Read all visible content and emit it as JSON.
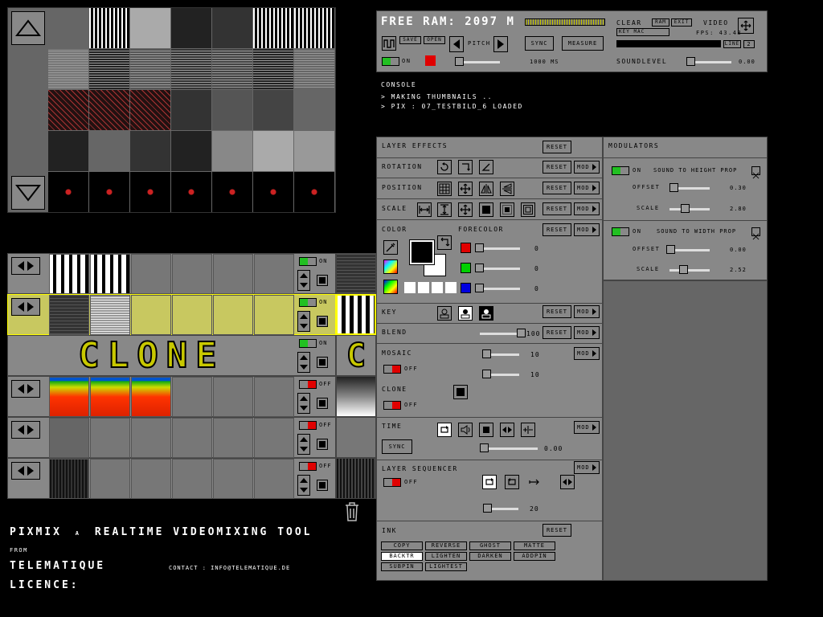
{
  "footer": {
    "app_name": "PIXMIX",
    "a": "A",
    "tagline": "REALTIME VIDEOMIXING TOOL",
    "from": "FROM",
    "company": "TELEMATIQUE",
    "licence": "LICENCE:",
    "contact": "CONTACT : INFO@TELEMATIQUE.DE"
  },
  "top": {
    "free_ram_label": "FREE RAM:",
    "free_ram_value": "2097 M",
    "clear": "CLEAR",
    "ram": "RAM",
    "exit": "EXIT",
    "video": "VIDEO",
    "key_mac": "KEY MAC",
    "fps_label": "FPS:",
    "fps_value": "43.48",
    "line": "LINE",
    "line_value": "2",
    "save": "SAVE",
    "open": "OPEN",
    "pitch": "PITCH",
    "sync": "SYNC",
    "measure": "MEASURE",
    "on": "ON",
    "ms_value": "1000 MS",
    "soundlevel": "SOUNDLEVEL",
    "soundlevel_value": "0.00"
  },
  "console": {
    "title": "CONSOLE",
    "lines": [
      "> MAKING THUMBNAILS ..",
      "> PIX : 07_TESTBILD_6 LOADED"
    ]
  },
  "effects": {
    "layer_effects": "LAYER EFFECTS",
    "reset": "RESET",
    "mod": "MOD",
    "rotation": "ROTATION",
    "position": "POSITION",
    "scale": "SCALE",
    "color": "COLOR",
    "forecolor": "FORECOLOR",
    "r_value": "0",
    "g_value": "0",
    "b_value": "0",
    "key": "KEY",
    "blend": "BLEND",
    "blend_value": "100",
    "mosaic": "MOSAIC",
    "mosaic_x": "10",
    "mosaic_y": "10",
    "off": "OFF",
    "clone": "CLONE",
    "time": "TIME",
    "time_sync": "SYNC",
    "time_value": "0.00",
    "layer_sequencer": "LAYER SEQUENCER",
    "seq_value": "20",
    "ink": "INK",
    "ink_buttons": [
      "COPY",
      "REVERSE",
      "GHOST",
      "MATTE",
      "BACKTR",
      "LIGHTEN",
      "DARKEN",
      "ADDPIN",
      "SUBPIN",
      "LIGHTEST"
    ]
  },
  "modulators": {
    "title": "MODULATORS",
    "m1": {
      "on": "ON",
      "label": "SOUND TO HEIGHT PROP",
      "offset": "OFFSET",
      "offset_value": "0.30",
      "scale": "SCALE",
      "scale_value": "2.80"
    },
    "m2": {
      "on": "ON",
      "label": "SOUND TO WIDTH PROP",
      "offset": "OFFSET",
      "offset_value": "0.00",
      "scale": "SCALE",
      "scale_value": "2.52"
    }
  },
  "layers": {
    "on": "ON",
    "off": "OFF",
    "clone_text": "CLONE",
    "clone_side": "C",
    "states": [
      "ON",
      "ON",
      "ON",
      "OFF",
      "OFF",
      "OFF"
    ]
  },
  "colors": {
    "accent_green": "#22c022",
    "accent_red": "#e00000",
    "selection": "#c8c860",
    "panel": "#888888"
  }
}
